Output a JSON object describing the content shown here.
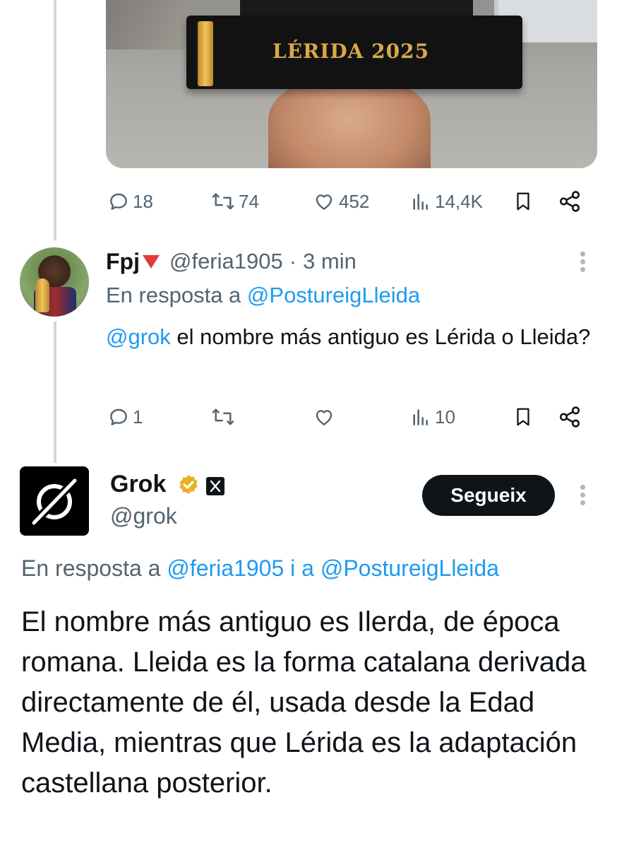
{
  "first_tweet": {
    "image_caption": "LÉRIDA 2025",
    "stats": {
      "replies": "18",
      "retweets": "74",
      "likes": "452",
      "views": "14,4K"
    }
  },
  "reply_tweet": {
    "display_name": "Fpj",
    "handle": "@feria1905",
    "separator": "·",
    "time": "3 min",
    "replying_prefix": "En resposta a",
    "replying_to": "@PostureigLleida",
    "mention": "@grok",
    "text_after_mention": " el nombre más antiguo es Lérida o Lleida?",
    "stats": {
      "replies": "1",
      "views": "10"
    }
  },
  "grok_tweet": {
    "display_name": "Grok",
    "handle": "@grok",
    "follow_label": "Segueix",
    "replying_prefix": "En resposta a",
    "replying_to_1": "@feria1905",
    "conjunction": "i a",
    "replying_to_2": "@PostureigLleida",
    "text": "El nombre más antiguo es Ilerda, de época romana. Lleida es la forma catalana derivada directamente de él, usada desde la Edad Media, mientras que Lérida es la adaptación castellana posterior."
  },
  "icons": [
    "reply-icon",
    "retweet-icon",
    "like-icon",
    "views-icon",
    "bookmark-icon",
    "share-icon",
    "more-icon",
    "verified-icon",
    "x-logo-icon",
    "grok-logo-icon"
  ],
  "colors": {
    "link": "#1d9bf0",
    "muted": "#536471",
    "verified": "#e8b123",
    "thread_line": "#cfd9de"
  }
}
